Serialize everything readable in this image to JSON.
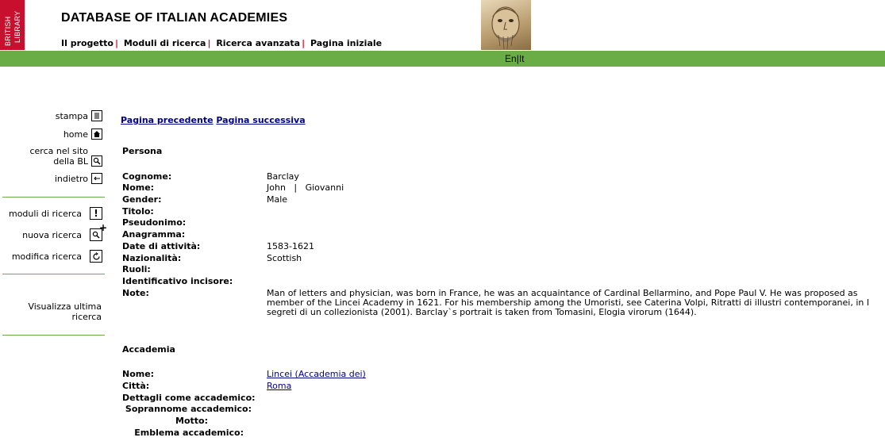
{
  "header": {
    "logo_line1": "BRITISH",
    "logo_line2": "LIBRARY",
    "title": "DATABASE OF ITALIAN ACADEMIES",
    "nav": [
      "Il progetto",
      "Moduli di ricerca",
      "Ricerca avanzata",
      "Pagina iniziale"
    ],
    "lang_en": "En",
    "lang_sep": "|",
    "lang_it": "It"
  },
  "sidebar": {
    "stampa": "stampa",
    "home": "home",
    "cerca_line1": "cerca nel sito",
    "cerca_line2": "della BL",
    "indietro": "indietro",
    "moduli": "moduli di ricerca",
    "nuova": "nuova ricerca",
    "modifica": "modifica ricerca",
    "ultima_line1": "Visualizza ultima",
    "ultima_line2": "ricerca"
  },
  "pager": {
    "prev": "Pagina precedente",
    "next": "Pagina successiva"
  },
  "persona": {
    "heading": "Persona",
    "fields": [
      {
        "label": "Cognome:",
        "value": "Barclay"
      },
      {
        "label": "Nome:",
        "value": "John   |   Giovanni"
      },
      {
        "label": "Gender:",
        "value": "Male"
      },
      {
        "label": "Titolo:",
        "value": ""
      },
      {
        "label": "Pseudonimo:",
        "value": ""
      },
      {
        "label": "Anagramma:",
        "value": ""
      },
      {
        "label": "Date di attività:",
        "value": "1583-1621"
      },
      {
        "label": "Nazionalità:",
        "value": "Scottish"
      },
      {
        "label": "Ruoli:",
        "value": ""
      },
      {
        "label": "Identificativo incisore:",
        "value": ""
      },
      {
        "label": "Note:",
        "value": "Man of letters and physician, was born in France, he was an acquaintance of Cardinal Bellarmino, and Pope Paul V. He was proposed as member of the Lincei Academy in 1621. For his membership among the Umoristi, see Caterina Volpi, Ritratti di illustri contemporanei, in I segreti di un collezionista (2001). Barclay`s portrait is taken from Tomasini, Elogia virorum (1644)."
      }
    ]
  },
  "accademia": {
    "heading": "Accademia",
    "nome_label": "Nome:",
    "nome_value": "Lincei (Accademia dei)",
    "citta_label": "Città:",
    "citta_value": "Roma",
    "dettagli_label": "Dettagli come accademico:",
    "soprannome_label": "Soprannome accademico:",
    "motto_label": "Motto:",
    "emblema_label": "Emblema accademico:"
  },
  "colors": {
    "brand_red": "#c8102e",
    "green_bar": "#6aad46",
    "link": "#00008b"
  }
}
